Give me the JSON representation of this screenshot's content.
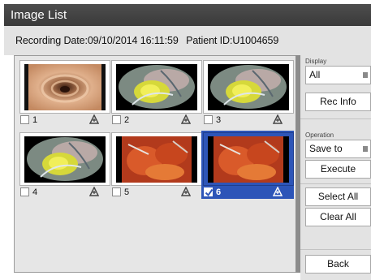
{
  "window": {
    "title": "Image List"
  },
  "info": {
    "recording_date": "Recording Date:09/10/2014 16:11:59",
    "patient_id": "Patient ID:U1004659"
  },
  "images": [
    {
      "number": "1",
      "checked": false,
      "selected": false,
      "kind": "tunnel-endoscopy"
    },
    {
      "number": "2",
      "checked": false,
      "selected": false,
      "kind": "yellow-endoscopy"
    },
    {
      "number": "3",
      "checked": false,
      "selected": false,
      "kind": "yellow-endoscopy"
    },
    {
      "number": "4",
      "checked": false,
      "selected": false,
      "kind": "yellow-endoscopy"
    },
    {
      "number": "5",
      "checked": false,
      "selected": false,
      "kind": "red-surgical"
    },
    {
      "number": "6",
      "checked": true,
      "selected": true,
      "kind": "red-surgical"
    }
  ],
  "sidebar": {
    "display_label": "Display",
    "display_value": "All",
    "rec_info": "Rec Info",
    "operation_label": "Operation",
    "operation_value": "Save to",
    "execute": "Execute",
    "select_all": "Select All",
    "clear_all": "Clear All",
    "back": "Back"
  },
  "colors": {
    "selection": "#2d55b8",
    "titlebar": "#444444"
  }
}
